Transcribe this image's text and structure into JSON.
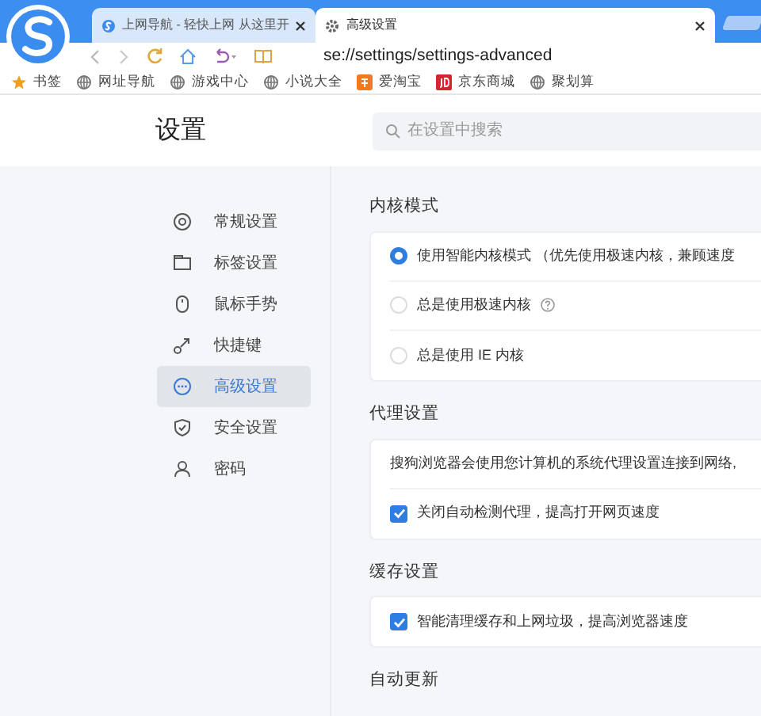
{
  "tabs": [
    {
      "title": "上网导航 - 轻快上网 从这里开",
      "selected": false,
      "kind": "sogou"
    },
    {
      "title": "高级设置",
      "selected": true,
      "kind": "gear"
    }
  ],
  "toolbar": {
    "address": "se://settings/settings-advanced"
  },
  "bookmarks": [
    {
      "label": "书签",
      "kind": "star"
    },
    {
      "label": "网址导航",
      "kind": "globe"
    },
    {
      "label": "游戏中心",
      "kind": "globe"
    },
    {
      "label": "小说大全",
      "kind": "globe"
    },
    {
      "label": "爱淘宝",
      "kind": "taobao"
    },
    {
      "label": "京东商城",
      "kind": "jd"
    },
    {
      "label": "聚划算",
      "kind": "globe"
    }
  ],
  "header": {
    "title": "设置",
    "search_placeholder": "在设置中搜索"
  },
  "sidebar": {
    "items": [
      {
        "label": "常规设置",
        "kind": "general",
        "selected": false
      },
      {
        "label": "标签设置",
        "kind": "tab",
        "selected": false
      },
      {
        "label": "鼠标手势",
        "kind": "mouse",
        "selected": false
      },
      {
        "label": "快捷键",
        "kind": "shortcut",
        "selected": false
      },
      {
        "label": "高级设置",
        "kind": "advanced",
        "selected": true
      },
      {
        "label": "安全设置",
        "kind": "shield",
        "selected": false
      },
      {
        "label": "密码",
        "kind": "person",
        "selected": false
      }
    ]
  },
  "sections": [
    {
      "title": "内核模式",
      "items": [
        {
          "kind": "radio",
          "label": "使用智能内核模式 （优先使用极速内核，兼顾速度",
          "selected": true,
          "help": false
        },
        {
          "kind": "radio",
          "label": "总是使用极速内核",
          "selected": false,
          "help": true
        },
        {
          "kind": "radio",
          "label": "总是使用 IE 内核",
          "selected": false,
          "help": false
        }
      ]
    },
    {
      "title": "代理设置",
      "items": [
        {
          "kind": "text",
          "label": "搜狗浏览器会使用您计算机的系统代理设置连接到网络,"
        },
        {
          "kind": "checkbox",
          "label": "关闭自动检测代理，提高打开网页速度",
          "checked": true
        }
      ]
    },
    {
      "title": "缓存设置",
      "items": [
        {
          "kind": "checkbox",
          "label": "智能清理缓存和上网垃圾，提高浏览器速度",
          "checked": true
        }
      ]
    },
    {
      "title": "自动更新"
    }
  ]
}
